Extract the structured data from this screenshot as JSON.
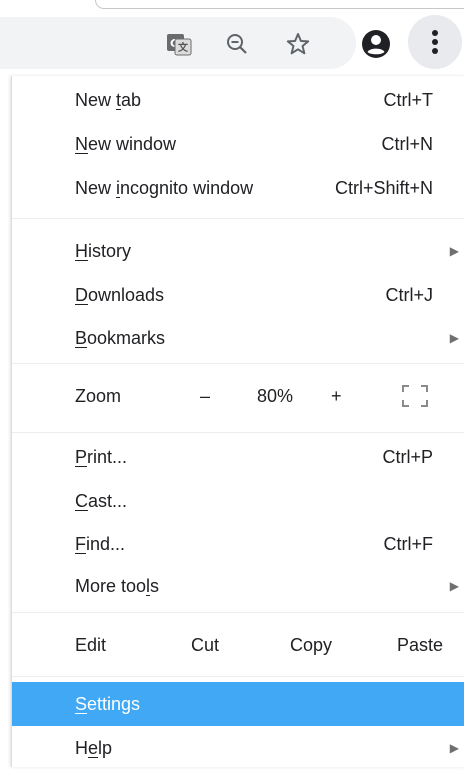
{
  "toolbar": {
    "icons": [
      "translate-icon",
      "zoom-out-icon",
      "bookmark-star-icon",
      "account-icon",
      "more-vert-icon"
    ]
  },
  "menu": {
    "new_tab": {
      "pre": "New ",
      "ul": "t",
      "post": "ab",
      "shortcut": "Ctrl+T"
    },
    "new_window": {
      "pre": "",
      "ul": "N",
      "post": "ew window",
      "shortcut": "Ctrl+N"
    },
    "new_incognito": {
      "pre": "New ",
      "ul": "i",
      "post": "ncognito window",
      "shortcut": "Ctrl+Shift+N"
    },
    "history": {
      "pre": "",
      "ul": "H",
      "post": "istory"
    },
    "downloads": {
      "pre": "",
      "ul": "D",
      "post": "ownloads",
      "shortcut": "Ctrl+J"
    },
    "bookmarks": {
      "pre": "",
      "ul": "B",
      "post": "ookmarks"
    },
    "zoom": {
      "label": "Zoom",
      "minus": "–",
      "value": "80%",
      "plus": "+"
    },
    "print": {
      "pre": "",
      "ul": "P",
      "post": "rint...",
      "shortcut": "Ctrl+P"
    },
    "cast": {
      "pre": "",
      "ul": "C",
      "post": "ast..."
    },
    "find": {
      "pre": "",
      "ul": "F",
      "post": "ind...",
      "shortcut": "Ctrl+F"
    },
    "more_tools": {
      "pre": "More too",
      "ul": "l",
      "post": "s"
    },
    "edit": {
      "label": "Edit",
      "cut": "Cut",
      "copy": "Copy",
      "paste": "Paste"
    },
    "settings": {
      "pre": "",
      "ul": "S",
      "post": "ettings"
    },
    "help": {
      "pre": "H",
      "ul": "e",
      "post": "lp"
    },
    "selected_item": "settings",
    "selected_color": "#40a8f5"
  }
}
